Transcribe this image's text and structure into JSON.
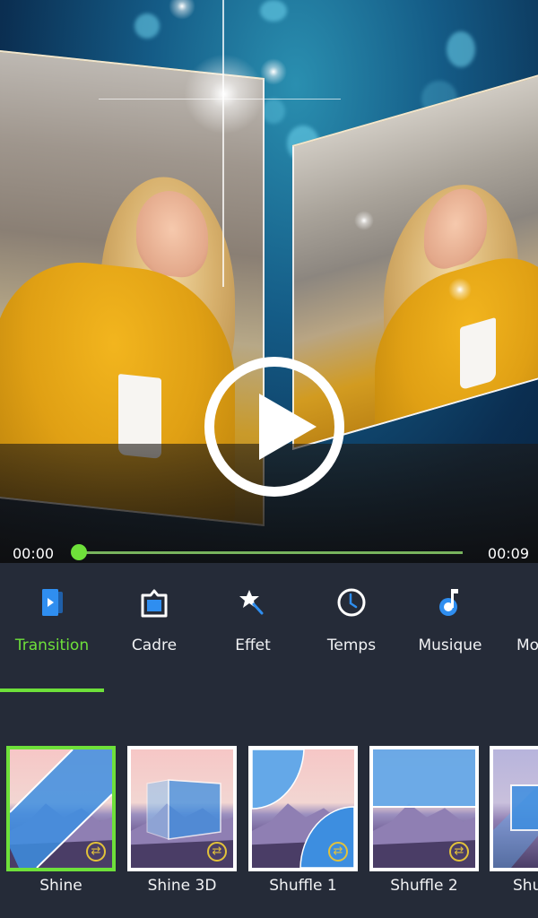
{
  "player": {
    "current_time": "00:00",
    "total_time": "00:09",
    "progress_fraction": 0.0,
    "play_icon": "play-icon"
  },
  "toolbar": {
    "items": [
      {
        "label": "Transition",
        "icon": "transition-icon",
        "active": true
      },
      {
        "label": "Cadre",
        "icon": "frame-icon",
        "active": false
      },
      {
        "label": "Effet",
        "icon": "magic-wand-icon",
        "active": false
      },
      {
        "label": "Temps",
        "icon": "clock-icon",
        "active": false
      },
      {
        "label": "Musique",
        "icon": "music-note-icon",
        "active": false
      },
      {
        "label": "Mo",
        "icon": "more-icon",
        "active": false
      }
    ]
  },
  "transitions": {
    "items": [
      {
        "label": "Shine",
        "selected": true,
        "badge_icon": "shuffle-icon"
      },
      {
        "label": "Shine 3D",
        "selected": false,
        "badge_icon": "shuffle-icon"
      },
      {
        "label": "Shuffle 1",
        "selected": false,
        "badge_icon": "shuffle-icon"
      },
      {
        "label": "Shuffle 2",
        "selected": false,
        "badge_icon": "shuffle-icon"
      },
      {
        "label": "Shu",
        "selected": false,
        "badge_icon": "shuffle-icon"
      }
    ]
  },
  "colors": {
    "accent": "#6ee03a",
    "background": "#252b38",
    "icon_blue": "#2f8ef0",
    "badge": "#e2c23a"
  }
}
